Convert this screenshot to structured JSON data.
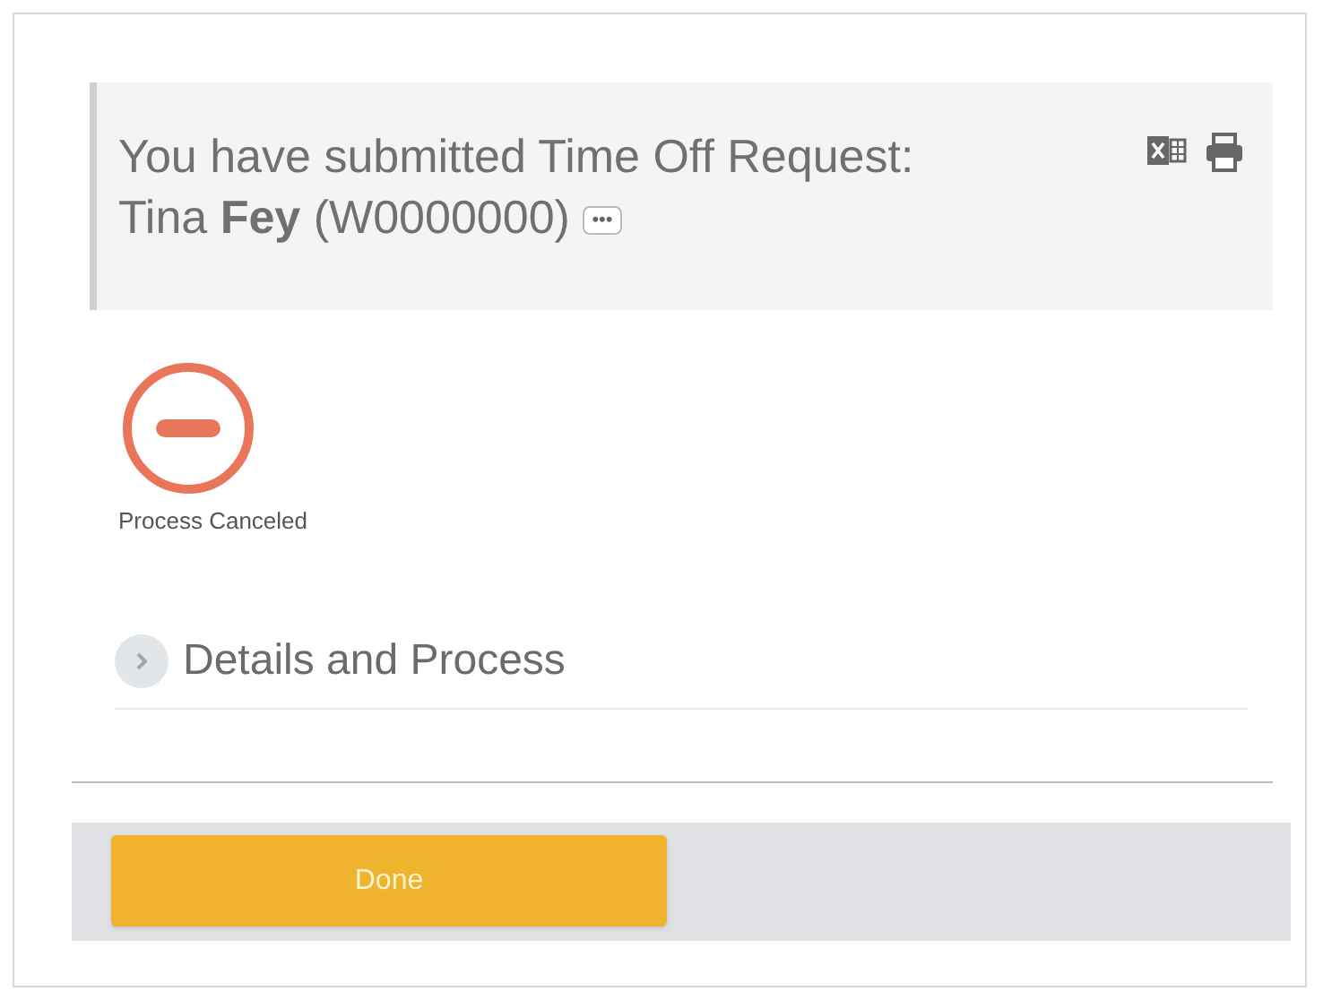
{
  "header": {
    "title": "You have submitted  Time Off Request: Tina **Fey** (W0000000)",
    "more_button": "•••"
  },
  "status": {
    "kind": "canceled",
    "label": "Process Canceled"
  },
  "details": {
    "label": "Details and Process",
    "expanded": false
  },
  "footer": {
    "buttons": [
      "Done"
    ]
  }
}
